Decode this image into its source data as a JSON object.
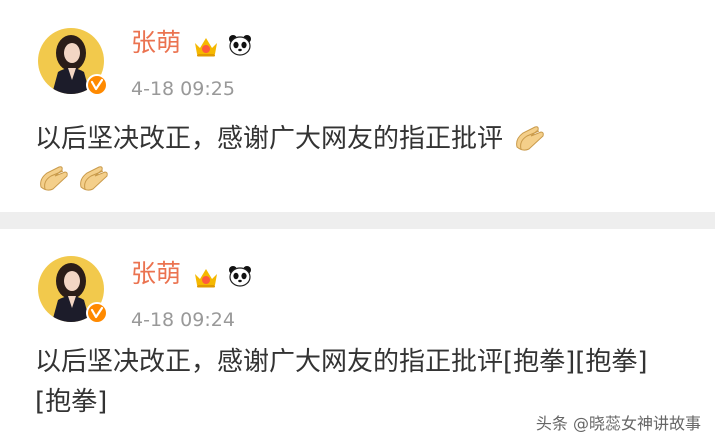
{
  "posts": [
    {
      "username": "张萌",
      "timestamp": "4-18 09:25",
      "text": "以后坚决改正，感谢广大网友的指正批评",
      "badge_icons": [
        "crown-icon",
        "panda-icon"
      ],
      "emoji_icon": "clapping-hands-icon",
      "emoji_count": 3
    },
    {
      "username": "张萌",
      "timestamp": "4-18 09:24",
      "text": "以后坚决改正，感谢广大网友的指正批评[抱拳][抱拳][抱拳]",
      "badge_icons": [
        "crown-icon",
        "panda-icon"
      ]
    }
  ],
  "watermark": "头条 @晓蕊女神讲故事",
  "colors": {
    "username": "#eb7350",
    "timestamp": "#999999",
    "text": "#333333",
    "separator": "#eeeeee",
    "avatar_background": "#f2c94c",
    "verified_badge": "#ff8a00"
  }
}
